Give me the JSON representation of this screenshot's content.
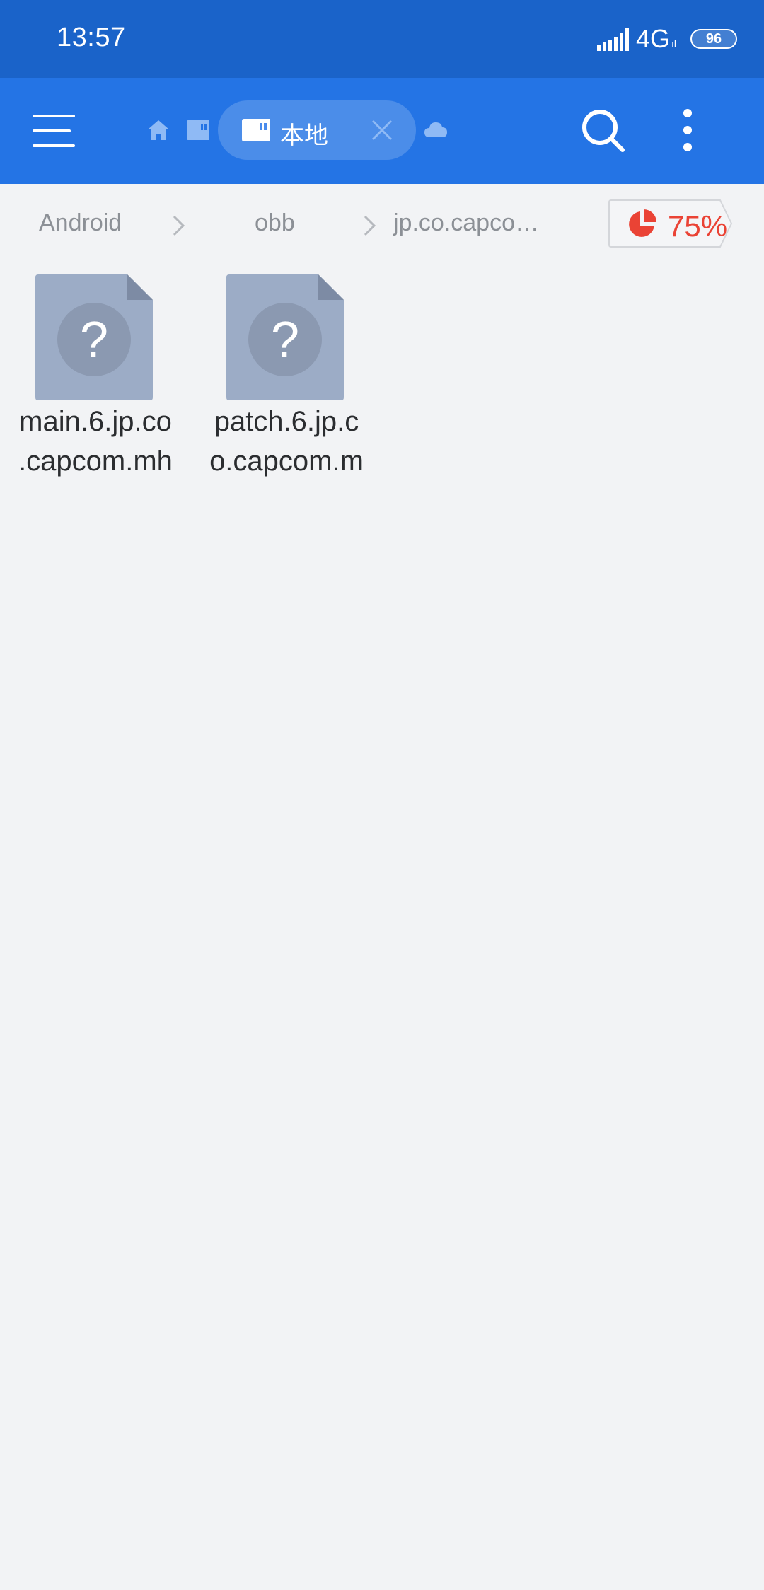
{
  "status_bar": {
    "time": "13:57",
    "network": "4G",
    "network_sub": "ıl",
    "battery": "96"
  },
  "app_bar": {
    "active_tab_label": "本地",
    "icons": [
      "menu-icon",
      "home-icon",
      "sdcard-icon",
      "close-icon",
      "cloud-icon",
      "search-icon",
      "more-vert-icon"
    ]
  },
  "breadcrumb": {
    "items": [
      "Android",
      "obb",
      "jp.co.capco…"
    ],
    "storage_usage": "75%",
    "storage_fraction": 0.75
  },
  "files": [
    {
      "name": "main.6.jp.co.capcom.mh",
      "line1": "main.6.jp.co",
      "line2": ".capcom.mh",
      "icon": "unknown-file-icon"
    },
    {
      "name": "patch.6.jp.co.capcom.m",
      "line1": "patch.6.jp.c",
      "line2": "o.capcom.m",
      "icon": "unknown-file-icon"
    }
  ],
  "colors": {
    "status_bar": "#1a63c9",
    "app_bar": "#2474e5",
    "background": "#f2f3f5",
    "storage_accent": "#ea4335",
    "file_icon": "#9cacc6"
  }
}
